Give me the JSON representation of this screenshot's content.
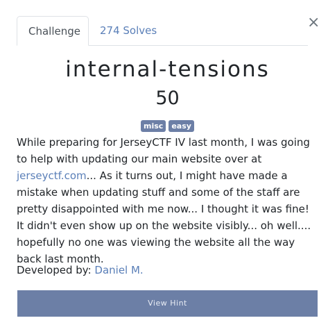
{
  "modal": {
    "close_symbol": "×"
  },
  "tabs": [
    {
      "label": "Challenge",
      "active": true
    },
    {
      "label": "274 Solves",
      "active": false
    }
  ],
  "challenge": {
    "name": "internal-tensions",
    "points": "50",
    "tags": [
      "misc",
      "easy"
    ],
    "description_before_link": "While preparing for JerseyCTF IV last month, I was going to help with updating our main website over at ",
    "description_link": "jerseyctf.com",
    "description_after_link": "... As it turns out, I might have made a mistake when updating stuff and some of the staff are pretty disappointed with me now... I thought it was fine! It didn't even show up on the website visibly... oh well.... hopefully no one was viewing the website all the way back last month.",
    "author_prefix": "Developed by: ",
    "author_name": "Daniel M.",
    "hint_button_label": "View Hint"
  },
  "colors": {
    "link": "#5a7fb8",
    "tag_background": "#6c7fa6",
    "button_background": "#6c7fa6"
  }
}
